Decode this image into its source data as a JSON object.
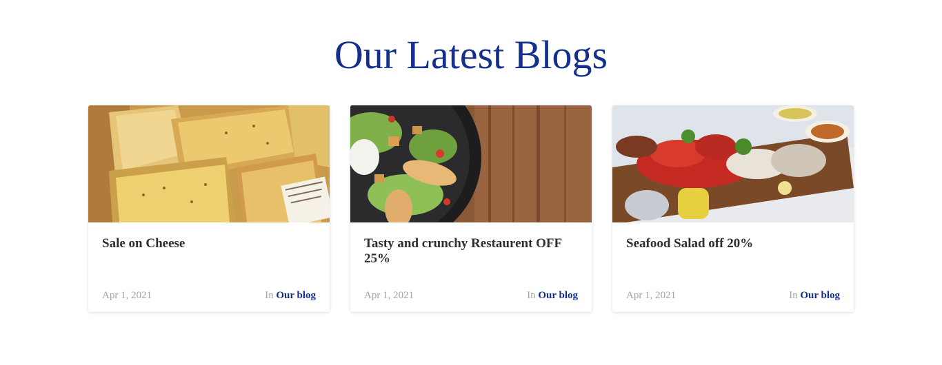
{
  "section": {
    "title": "Our Latest Blogs"
  },
  "colors": {
    "accent": "#14308c",
    "title_text": "#2e2e2e",
    "muted_text": "#a3a3a3"
  },
  "posts": [
    {
      "image": "cheese-image",
      "title": "Sale on Cheese",
      "date": "Apr 1, 2021",
      "category_prefix": "In",
      "category": "Our blog"
    },
    {
      "image": "salad-bowl-image",
      "title": "Tasty and crunchy Restaurent OFF 25%",
      "date": "Apr 1, 2021",
      "category_prefix": "In",
      "category": "Our blog"
    },
    {
      "image": "seafood-platter-image",
      "title": "Seafood Salad off 20%",
      "date": "Apr 1, 2021",
      "category_prefix": "In",
      "category": "Our blog"
    }
  ]
}
